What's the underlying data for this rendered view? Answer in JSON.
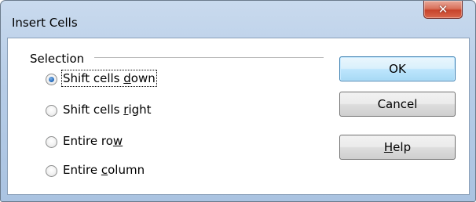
{
  "window": {
    "title": "Insert Cells",
    "close_glyph": "✕"
  },
  "selection": {
    "label": "Selection",
    "options": [
      {
        "pre": "Shift cells ",
        "accel": "d",
        "post": "own",
        "checked": true,
        "focused": true
      },
      {
        "pre": "Shift cells ",
        "accel": "r",
        "post": "ight",
        "checked": false,
        "focused": false
      },
      {
        "pre": "Entire ro",
        "accel": "w",
        "post": "",
        "checked": false,
        "focused": false
      },
      {
        "pre": "Entire ",
        "accel": "c",
        "post": "olumn",
        "checked": false,
        "focused": false
      }
    ]
  },
  "buttons": {
    "ok": "OK",
    "cancel": "Cancel",
    "help": {
      "pre": "",
      "accel": "H",
      "post": "elp"
    }
  },
  "colors": {
    "accent": "#3c7fb1",
    "close": "#c7432b",
    "frame": "#b7cde7"
  }
}
